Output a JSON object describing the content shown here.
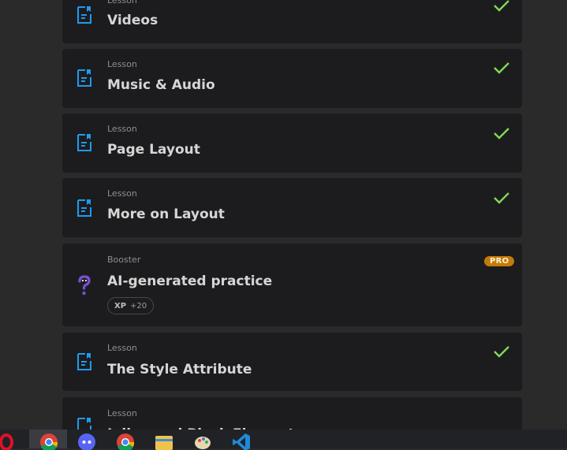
{
  "lessons": [
    {
      "kind": "Lesson",
      "title": "Videos",
      "completed": true
    },
    {
      "kind": "Lesson",
      "title": "Music & Audio",
      "completed": true
    },
    {
      "kind": "Lesson",
      "title": "Page Layout",
      "completed": true
    },
    {
      "kind": "Lesson",
      "title": "More on Layout",
      "completed": true
    },
    {
      "kind": "Booster",
      "title": "AI-generated practice",
      "badge": "PRO",
      "xp_label": "XP",
      "xp_value": "+20",
      "icon": "question-mark-icon"
    },
    {
      "kind": "Lesson",
      "title": "The Style Attribute",
      "completed": true
    },
    {
      "kind": "Lesson",
      "title": "Inline and Block Elements",
      "completed": false
    }
  ],
  "colors": {
    "accent_blue": "#1e9bf0",
    "check_green": "#7ed957",
    "pro_badge": "#c27b0a",
    "booster_purple": "#7b4fd6",
    "card_bg": "#1c1c1e",
    "page_bg": "#2a2a2b"
  },
  "taskbar": {
    "apps": [
      "opera-icon",
      "chrome-icon",
      "discord-icon",
      "chrome-icon",
      "file-explorer-icon",
      "paint-icon",
      "vscode-icon"
    ]
  }
}
